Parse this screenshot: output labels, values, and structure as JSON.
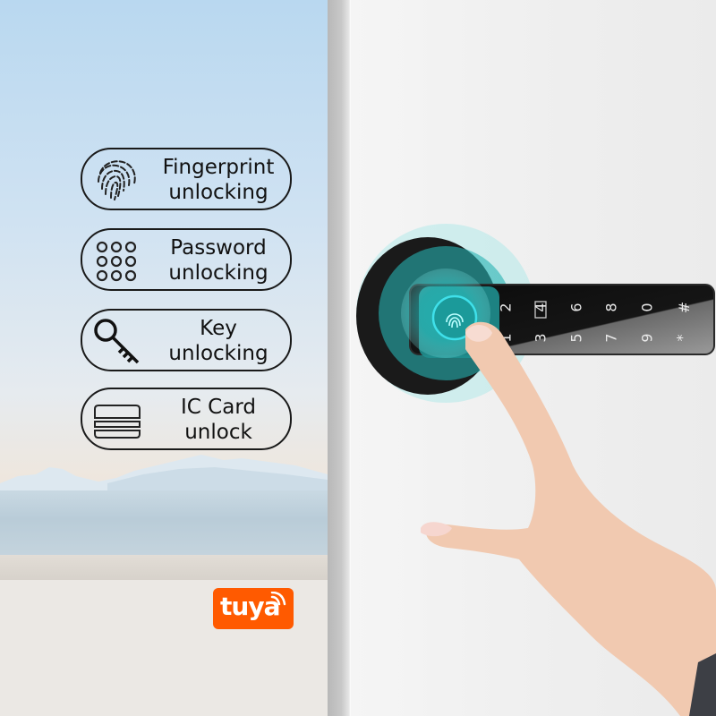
{
  "features": [
    {
      "icon": "fingerprint-icon",
      "line1": "Fingerprint",
      "line2": "unlocking"
    },
    {
      "icon": "keypad-icon",
      "line1": "Password",
      "line2": "unlocking"
    },
    {
      "icon": "key-icon",
      "line1": "Key",
      "line2": "unlocking"
    },
    {
      "icon": "ic-card-icon",
      "line1": "IC Card",
      "line2": "unlock"
    }
  ],
  "brand": {
    "name": "tuya",
    "color": "#ff5a00"
  },
  "lock": {
    "accent_color": "#2ec4c4",
    "keypad_top_row": [
      "2",
      "4",
      "6",
      "8",
      "0",
      "#"
    ],
    "keypad_bottom_row": [
      "1",
      "3",
      "5",
      "7",
      "9",
      "*"
    ]
  }
}
